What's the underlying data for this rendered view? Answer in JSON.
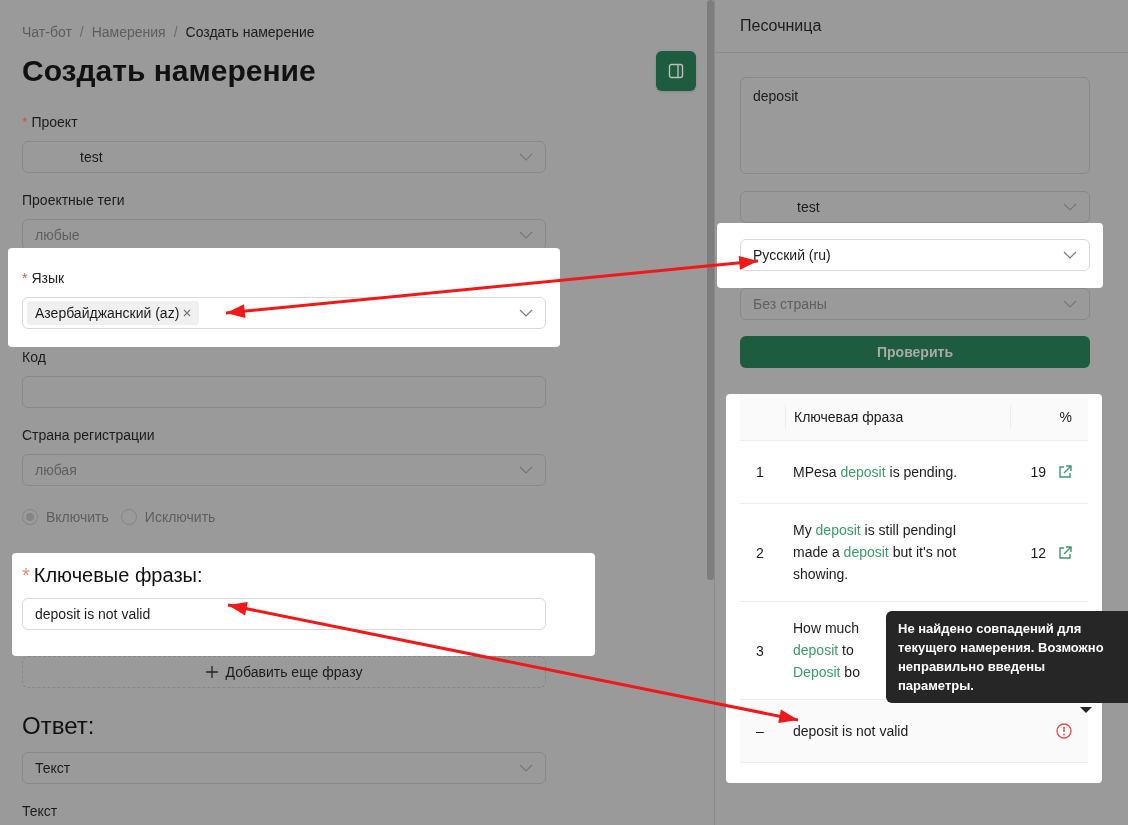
{
  "breadcrumb_separator": "/",
  "required_mark": "*",
  "breadcrumb": [
    {
      "label": "Чат-бот",
      "current": false
    },
    {
      "label": "Намерения",
      "current": false
    },
    {
      "label": "Создать намерение",
      "current": true
    }
  ],
  "title": "Создать намерение",
  "form": {
    "project": {
      "label": "Проект",
      "required": true,
      "value": "test"
    },
    "tags": {
      "label": "Проектные теги",
      "placeholder": "любые"
    },
    "language": {
      "label": "Язык",
      "required": true,
      "highlighted": true,
      "chips": [
        "Азербайджанский (az)"
      ]
    },
    "code": {
      "label": "Код"
    },
    "country": {
      "label": "Страна регистрации",
      "placeholder": "любая"
    },
    "mode": [
      {
        "label": "Включить",
        "selected": true
      },
      {
        "label": "Исключить",
        "selected": false
      }
    ],
    "phrases": {
      "label": "Ключевые фразы:",
      "required": true,
      "highlighted": true,
      "values": [
        "deposit is not valid"
      ],
      "add_label": "Добавить еще фразу"
    },
    "answer": {
      "label": "Ответ:",
      "type": "Текст"
    },
    "text": {
      "label": "Текст"
    }
  },
  "sandbox": {
    "title": "Песочница",
    "query": "deposit",
    "project": "test",
    "language": "Русский (ru)",
    "language_highlighted": true,
    "country_placeholder": "Без страны",
    "check_button": "Проверить",
    "table": {
      "highlighted": true,
      "columns": [
        "Ключевая фраза",
        "%"
      ],
      "rows": [
        {
          "index": "1",
          "lines": [
            [
              {
                "text": "MPesa ",
                "match": false
              },
              {
                "text": "deposit",
                "match": true
              },
              {
                "text": " is pending.",
                "match": false
              }
            ]
          ],
          "percent": "19",
          "kind": "link"
        },
        {
          "index": "2",
          "lines": [
            [
              {
                "text": "My ",
                "match": false
              },
              {
                "text": "deposit",
                "match": true
              },
              {
                "text": " is still pendingI",
                "match": false
              }
            ],
            [
              {
                "text": "made a ",
                "match": false
              },
              {
                "text": "deposit",
                "match": true
              },
              {
                "text": " but it's not",
                "match": false
              }
            ],
            [
              {
                "text": "showing.",
                "match": false
              }
            ]
          ],
          "percent": "12",
          "kind": "link"
        },
        {
          "index": "3",
          "lines": [
            [
              {
                "text": "How much",
                "match": false
              }
            ],
            [
              {
                "text": "deposit",
                "match": true
              },
              {
                "text": " to",
                "match": false
              }
            ],
            [
              {
                "text": "Deposit",
                "match": true
              },
              {
                "text": " bo",
                "match": false
              }
            ]
          ]
        },
        {
          "index": "–",
          "lines": [
            [
              {
                "text": "deposit is not valid",
                "match": false
              }
            ]
          ],
          "kind": "error"
        }
      ]
    },
    "tooltip": "Не найдено совпадений для текущего намерения. Возможно неправильно введены параметры."
  }
}
